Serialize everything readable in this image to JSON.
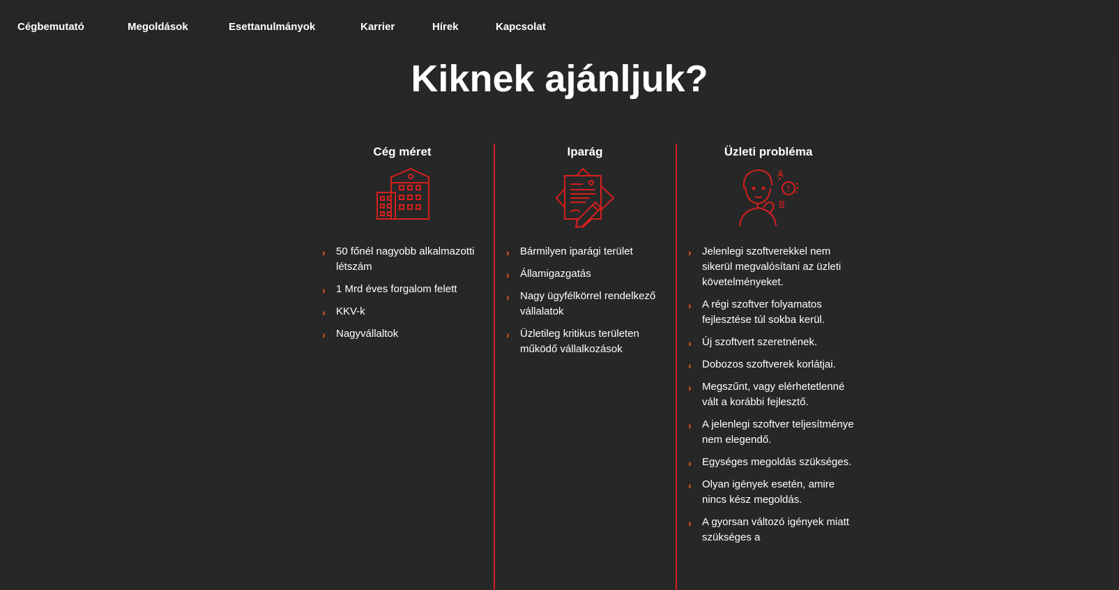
{
  "nav": {
    "items": [
      {
        "label": "Cégbemutató"
      },
      {
        "label": "Megoldások"
      },
      {
        "label": "Esettanulmányok"
      },
      {
        "label": "Karrier"
      },
      {
        "label": "Hírek"
      },
      {
        "label": "Kapcsolat"
      }
    ]
  },
  "page_title": "Kiknek ajánljuk?",
  "colors": {
    "background": "#272727",
    "accent": "#d5201d",
    "bullet": "#ff5a1f"
  },
  "columns": [
    {
      "title": "Cég méret",
      "icon": "office-building-icon",
      "items": [
        "50 főnél nagyobb alkalmazotti létszám",
        "1 Mrd éves forgalom felett",
        "KKV-k",
        "Nagyvállaltok"
      ]
    },
    {
      "title": "Iparág",
      "icon": "documents-pen-icon",
      "items": [
        "Bármilyen iparági terület",
        "Államigazgatás",
        "Nagy ügyfélkörrel rendelkező vállalatok",
        "Üzletileg kritikus területen működő vállalkozások"
      ]
    },
    {
      "title": "Üzleti probléma",
      "icon": "thinking-person-icon",
      "items": [
        "Jelenlegi szoftverekkel nem sikerül megvalósítani az üzleti követelményeket.",
        "A régi szoftver folyamatos fejlesztése túl sokba kerül.",
        "Új szoftvert szeretnének.",
        "Dobozos szoftverek korlátjai.",
        "Megszűnt, vagy elérhetetlenné vált a korábbi fejlesztő.",
        "A jelenlegi szoftver teljesítménye nem elegendő.",
        "Egységes megoldás szükséges.",
        "Olyan igények esetén, amire nincs kész megoldás.",
        "A gyorsan változó igények miatt szükséges a"
      ]
    }
  ]
}
